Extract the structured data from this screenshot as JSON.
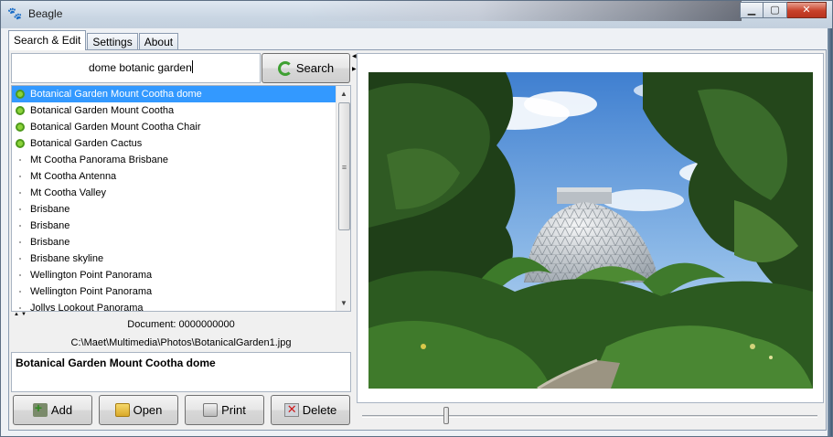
{
  "window": {
    "title": "Beagle",
    "controls": {
      "minimize": "▁",
      "maximize": "▢",
      "close": "✕"
    }
  },
  "tabs": [
    {
      "label": "Search & Edit",
      "active": true
    },
    {
      "label": "Settings",
      "active": false
    },
    {
      "label": "About",
      "active": false
    }
  ],
  "search": {
    "query": "dome botanic garden",
    "button_label": "Search"
  },
  "results": [
    {
      "label": "Botanical Garden Mount Cootha dome",
      "marked": true,
      "selected": true
    },
    {
      "label": "Botanical Garden Mount Cootha",
      "marked": true,
      "selected": false
    },
    {
      "label": "Botanical Garden Mount Cootha Chair",
      "marked": true,
      "selected": false
    },
    {
      "label": "Botanical Garden Cactus",
      "marked": true,
      "selected": false
    },
    {
      "label": "Mt Cootha Panorama Brisbane",
      "marked": false,
      "selected": false
    },
    {
      "label": "Mt Cootha Antenna",
      "marked": false,
      "selected": false
    },
    {
      "label": "Mt Cootha Valley",
      "marked": false,
      "selected": false
    },
    {
      "label": "Brisbane",
      "marked": false,
      "selected": false
    },
    {
      "label": "Brisbane",
      "marked": false,
      "selected": false
    },
    {
      "label": "Brisbane",
      "marked": false,
      "selected": false
    },
    {
      "label": "Brisbane skyline",
      "marked": false,
      "selected": false
    },
    {
      "label": "Wellington Point Panorama",
      "marked": false,
      "selected": false
    },
    {
      "label": "Wellington Point Panorama",
      "marked": false,
      "selected": false
    },
    {
      "label": "Jollys Lookout Panorama",
      "marked": false,
      "selected": false
    }
  ],
  "document": {
    "number_line": "Document: 0000000000",
    "path": "C:\\Maet\\Multimedia\\Photos\\BotanicalGarden1.jpg",
    "title": "Botanical Garden Mount Cootha dome"
  },
  "actions": {
    "add": "Add",
    "open": "Open",
    "print": "Print",
    "delete": "Delete"
  },
  "preview": {
    "slider_position_fraction": 0.18
  },
  "colors": {
    "selection": "#3399ff",
    "marker_green": "#8cd33b",
    "close_button": "#c8412a"
  }
}
